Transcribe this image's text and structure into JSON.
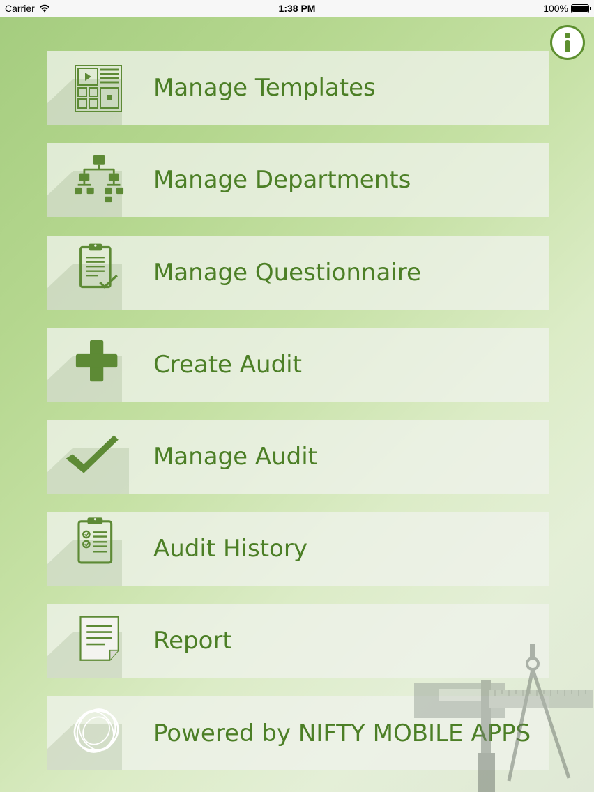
{
  "status_bar": {
    "carrier": "Carrier",
    "time": "1:38 PM",
    "battery": "100%"
  },
  "menu": {
    "items": [
      {
        "label": "Manage Templates",
        "icon": "templates-icon"
      },
      {
        "label": "Manage Departments",
        "icon": "org-chart-icon"
      },
      {
        "label": "Manage Questionnaire",
        "icon": "clipboard-check-icon"
      },
      {
        "label": "Create Audit",
        "icon": "plus-icon"
      },
      {
        "label": "Manage Audit",
        "icon": "checkmark-icon"
      },
      {
        "label": "Audit History",
        "icon": "checklist-icon"
      },
      {
        "label": "Report",
        "icon": "document-icon"
      },
      {
        "label": "Powered by NIFTY MOBILE APPS",
        "icon": "nifty-logo-icon"
      }
    ]
  },
  "colors": {
    "accent": "#4c7f26",
    "icon": "#5d8a35",
    "background": "#b5d78f"
  }
}
